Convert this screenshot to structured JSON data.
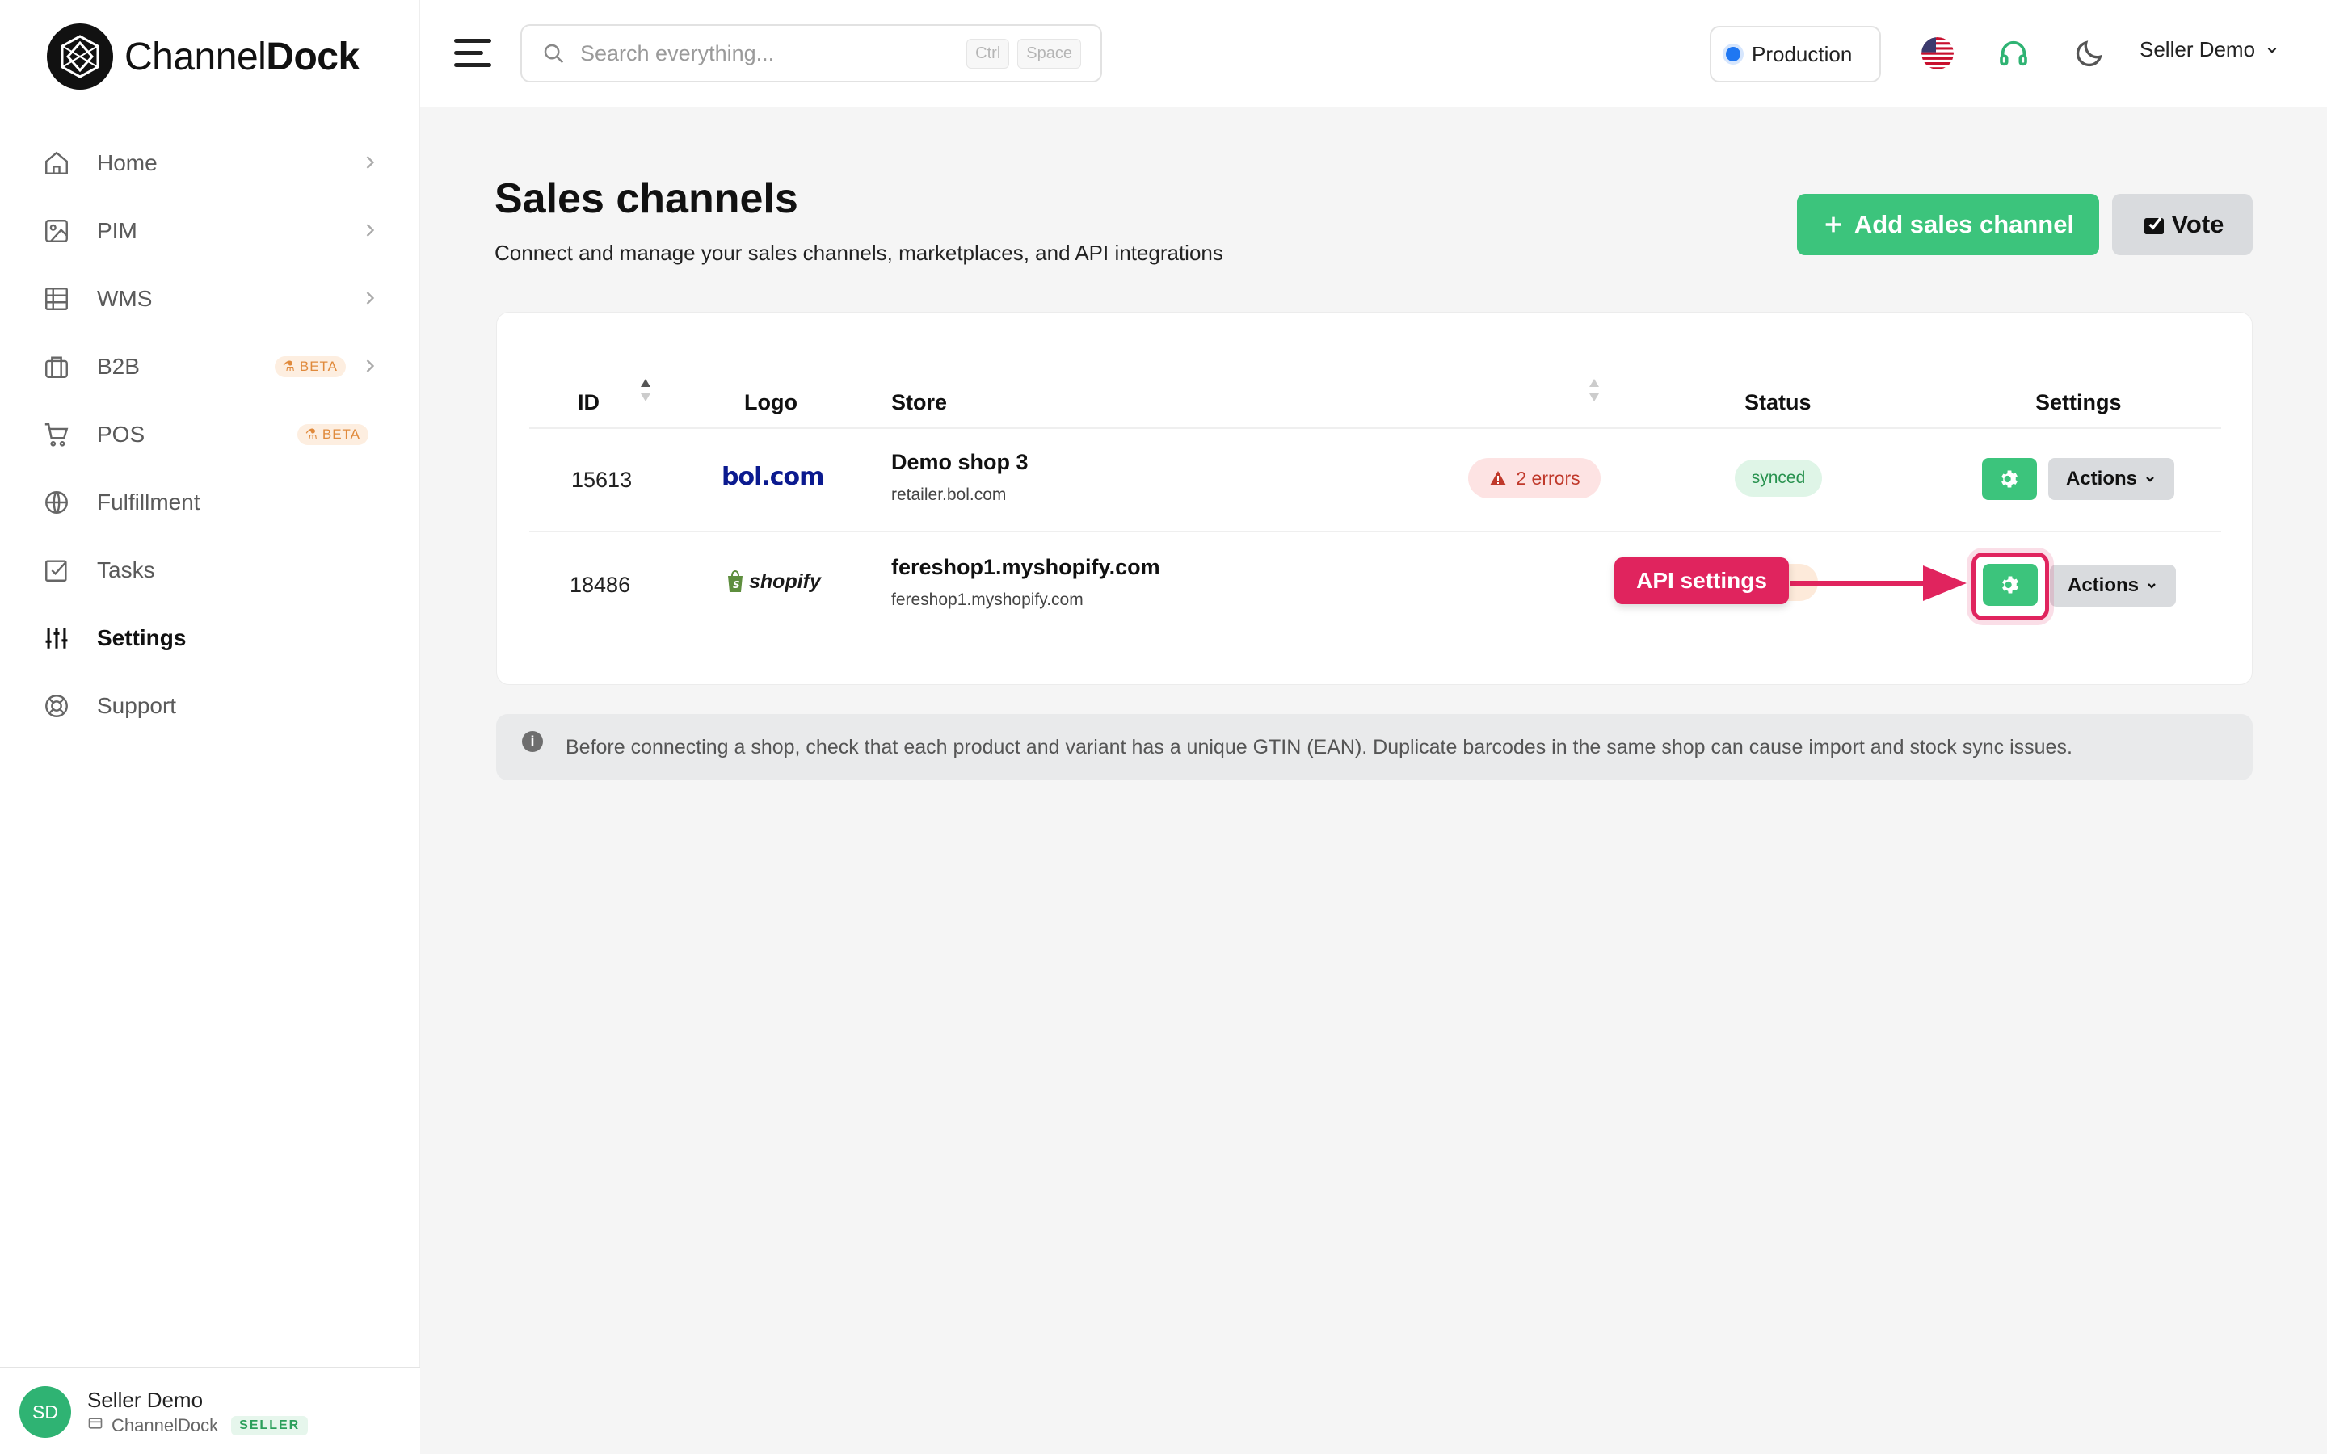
{
  "brand": {
    "name_light": "Channel",
    "name_bold": "Dock"
  },
  "sidebar": {
    "items": [
      {
        "label": "Home",
        "icon": "home-icon",
        "has_chevron": true
      },
      {
        "label": "PIM",
        "icon": "image-icon",
        "has_chevron": true
      },
      {
        "label": "WMS",
        "icon": "grid-icon",
        "has_chevron": true
      },
      {
        "label": "B2B",
        "icon": "briefcase-icon",
        "has_chevron": true,
        "badge": "BETA"
      },
      {
        "label": "POS",
        "icon": "cart-icon",
        "has_chevron": false,
        "badge": "BETA"
      },
      {
        "label": "Fulfillment",
        "icon": "globe-icon",
        "has_chevron": false
      },
      {
        "label": "Tasks",
        "icon": "checkbox-icon",
        "has_chevron": false
      },
      {
        "label": "Settings",
        "icon": "sliders-icon",
        "has_chevron": false,
        "active": true
      },
      {
        "label": "Support",
        "icon": "lifebuoy-icon",
        "has_chevron": false
      }
    ],
    "user": {
      "initials": "SD",
      "name": "Seller Demo",
      "org": "ChannelDock",
      "role": "SELLER"
    }
  },
  "header": {
    "search_placeholder": "Search everything...",
    "shortcut_keys": [
      "Ctrl",
      "Space"
    ],
    "environment": "Production",
    "account": "Seller Demo"
  },
  "page": {
    "title": "Sales channels",
    "subtitle": "Connect and manage your sales channels, marketplaces, and API integrations",
    "add_button": "Add sales channel",
    "vote_button": "Vote"
  },
  "table": {
    "columns": {
      "id": "ID",
      "logo": "Logo",
      "store": "Store",
      "status": "Status",
      "settings": "Settings"
    },
    "rows": [
      {
        "id": "15613",
        "logo": "bol.com",
        "store_name": "Demo shop 3",
        "store_url": "retailer.bol.com",
        "errors": "2 errors",
        "status": "synced",
        "actions": "Actions"
      },
      {
        "id": "18486",
        "logo": "shopify",
        "store_name": "fereshop1.myshopify.com",
        "store_url": "fereshop1.myshopify.com",
        "actions": "Actions"
      }
    ]
  },
  "callout": {
    "label": "API settings"
  },
  "info": {
    "text": "Before connecting a shop, check that each product and variant has a unique GTIN (EAN). Duplicate barcodes in the same shop can cause import and stock sync issues."
  },
  "colors": {
    "accent_green": "#3cc47c",
    "highlight": "#e0245e",
    "error": "#c0392b"
  }
}
